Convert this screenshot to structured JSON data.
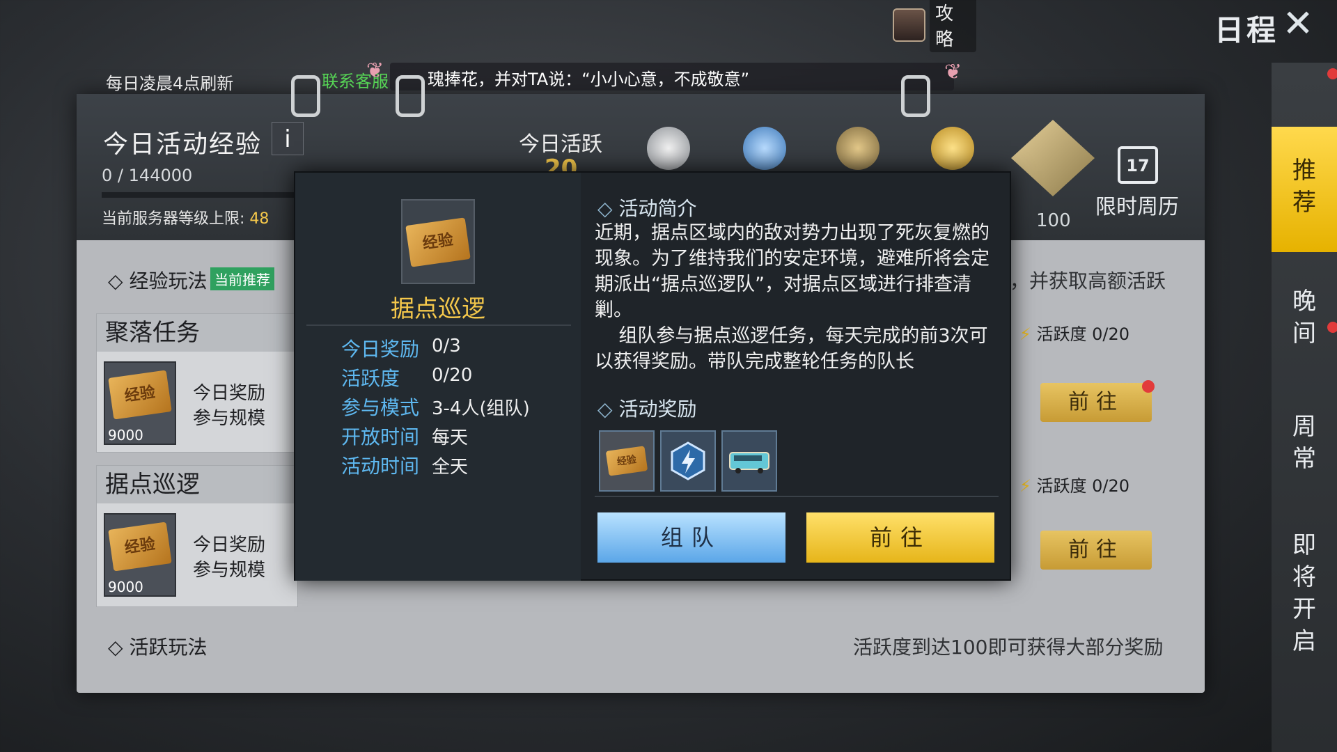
{
  "top": {
    "guide_label": "攻略",
    "schedule_title": "日程"
  },
  "header": {
    "refresh_note": "每日凌晨4点刷新",
    "contact_label": "联系客服",
    "marquee_text": "瑰捧花，并对TA说：“小小心意，不成敬意”",
    "exp_title": "今日活动经验",
    "info_label": "i",
    "exp_current": "0",
    "exp_separator": "/",
    "exp_max": "144000",
    "server_limit_label": "当前服务器等级上限:",
    "server_limit_value": "48",
    "active_today_label": "今日活跃",
    "active_today_value": "20",
    "milestone_100": "100",
    "calendar_day": "17",
    "calendar_label": "限时周历"
  },
  "sections": {
    "exp_play": "经验玩法",
    "exp_badge": "当前推荐",
    "exp_note": "，并获取高额活跃",
    "active_play": "活跃玩法",
    "active_note": "活跃度到达100即可获得大部分奖励"
  },
  "cards": [
    {
      "title": "聚落任务",
      "ticket_text": "经验",
      "count": "9000",
      "meta1": "今日奖励",
      "meta2": "参与规模",
      "activity_label": "活跃度",
      "activity_value": "0/20",
      "goto": "前往"
    },
    {
      "title": "据点巡逻",
      "ticket_text": "经验",
      "count": "9000",
      "meta1": "今日奖励",
      "meta2": "参与规模",
      "activity_label": "活跃度",
      "activity_value": "0/20",
      "goto": "前往"
    }
  ],
  "tabs": {
    "recommend": "推荐",
    "evening": "晚间",
    "weekly": "周常",
    "upcoming": "即将开启"
  },
  "popup": {
    "icon_text": "经验",
    "name": "据点巡逻",
    "rows": [
      {
        "label": "今日奖励",
        "value": "0/3"
      },
      {
        "label": "活跃度",
        "value": "0/20"
      },
      {
        "label": "参与模式",
        "value": "3-4人(组队)"
      },
      {
        "label": "开放时间",
        "value": "每天"
      },
      {
        "label": "活动时间",
        "value": "全天"
      }
    ],
    "intro_title": "活动简介",
    "intro_text": "近期，据点区域内的敌对势力出现了死灰复燃的现象。为了维持我们的安定环境，避难所将会定期派出“据点巡逻队”，对据点区域进行排查清剿。\n    组队参与据点巡逻任务，每天完成的前3次可以获得奖励。带队完成整轮任务的队长",
    "reward_title": "活动奖励",
    "reward_items": [
      "exp-ticket-icon",
      "energy-hexagon-icon",
      "supply-bus-icon"
    ],
    "team_button": "组队",
    "goto_button": "前往"
  },
  "colors": {
    "accent_yellow": "#f5c84b",
    "label_blue": "#5eb8f0",
    "contact_green": "#56d455",
    "badge_green": "#2fa15f"
  }
}
